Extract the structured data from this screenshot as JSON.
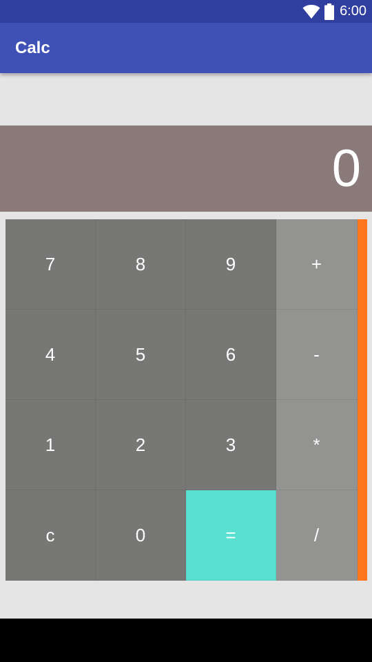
{
  "status_bar": {
    "time": "6:00",
    "icons": [
      "wifi-icon",
      "battery-icon"
    ]
  },
  "app_bar": {
    "title": "Calc"
  },
  "display": {
    "value": "0"
  },
  "keypad": {
    "rows": [
      [
        "7",
        "8",
        "9",
        "+"
      ],
      [
        "4",
        "5",
        "6",
        "-"
      ],
      [
        "1",
        "2",
        "3",
        "*"
      ],
      [
        "c",
        "0",
        "=",
        "/"
      ]
    ]
  },
  "colors": {
    "status_bar": "#303f9f",
    "app_bar": "#3f51b5",
    "display_bg": "#8a7b7a",
    "number_key": "#777775",
    "operator_key": "#939391",
    "equals_key": "#58dfcf",
    "side_strip": "#ff761c",
    "background": "#e5e5e5"
  }
}
